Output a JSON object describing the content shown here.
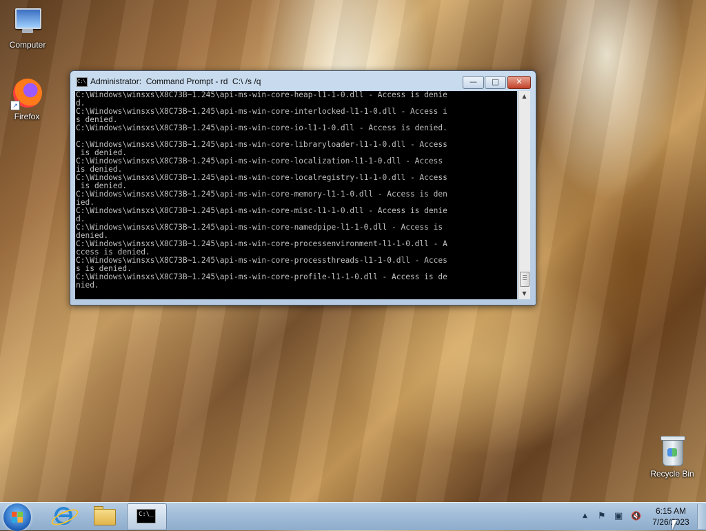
{
  "desktop": {
    "icons": [
      {
        "label": "Computer",
        "icon": "computer-icon"
      },
      {
        "label": "Firefox",
        "icon": "firefox-icon"
      },
      {
        "label": "Recycle Bin",
        "icon": "recycle-bin-icon"
      }
    ]
  },
  "window": {
    "title": "Administrator:  Command Prompt - rd  C:\\ /s /q",
    "buttons": {
      "minimize": "—",
      "maximize": "□",
      "close": "✕"
    },
    "console_text": "C:\\Windows\\winsxs\\X8C73B~1.245\\api-ms-win-core-heap-l1-1-0.dll - Access is denie\nd.\nC:\\Windows\\winsxs\\X8C73B~1.245\\api-ms-win-core-interlocked-l1-1-0.dll - Access i\ns denied.\nC:\\Windows\\winsxs\\X8C73B~1.245\\api-ms-win-core-io-l1-1-0.dll - Access is denied.\n\nC:\\Windows\\winsxs\\X8C73B~1.245\\api-ms-win-core-libraryloader-l1-1-0.dll - Access\n is denied.\nC:\\Windows\\winsxs\\X8C73B~1.245\\api-ms-win-core-localization-l1-1-0.dll - Access\nis denied.\nC:\\Windows\\winsxs\\X8C73B~1.245\\api-ms-win-core-localregistry-l1-1-0.dll - Access\n is denied.\nC:\\Windows\\winsxs\\X8C73B~1.245\\api-ms-win-core-memory-l1-1-0.dll - Access is den\nied.\nC:\\Windows\\winsxs\\X8C73B~1.245\\api-ms-win-core-misc-l1-1-0.dll - Access is denie\nd.\nC:\\Windows\\winsxs\\X8C73B~1.245\\api-ms-win-core-namedpipe-l1-1-0.dll - Access is\ndenied.\nC:\\Windows\\winsxs\\X8C73B~1.245\\api-ms-win-core-processenvironment-l1-1-0.dll - A\nccess is denied.\nC:\\Windows\\winsxs\\X8C73B~1.245\\api-ms-win-core-processthreads-l1-1-0.dll - Acces\ns is denied.\nC:\\Windows\\winsxs\\X8C73B~1.245\\api-ms-win-core-profile-l1-1-0.dll - Access is de\nnied."
  },
  "taskbar": {
    "start_icon": "windows-start-icon",
    "pinned": [
      "internet-explorer-icon",
      "file-explorer-icon",
      "command-prompt-icon"
    ],
    "cmd_glyph": "C:\\_",
    "tray_icons": [
      "show-hidden-icons-icon",
      "action-center-flag-icon",
      "network-icon",
      "volume-muted-icon"
    ],
    "tray_glyphs": {
      "chevron": "▲",
      "flag": "⚑",
      "network": "▣",
      "volume": "🔇"
    },
    "clock": {
      "time": "6:15 AM",
      "date": "7/26/2023"
    }
  }
}
